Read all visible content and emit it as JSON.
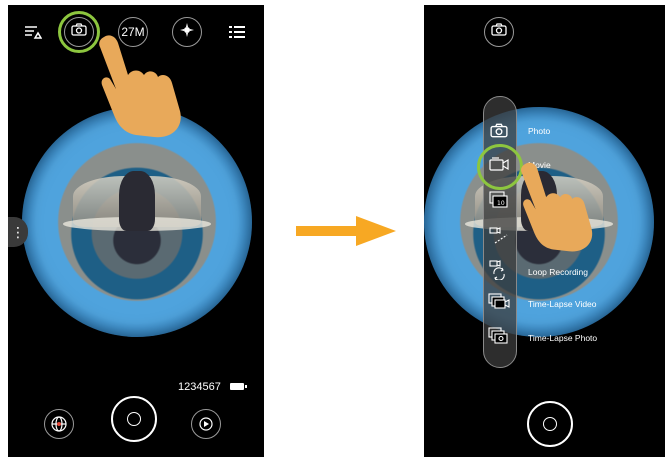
{
  "left_screen": {
    "top_bar": {
      "resolution_label": "27M"
    },
    "status": {
      "shots_remaining": "1234567"
    }
  },
  "right_screen": {
    "mode_menu": {
      "items": [
        {
          "label": "Photo",
          "icon": "camera-icon"
        },
        {
          "label": "Movie",
          "icon": "video-camera-icon"
        },
        {
          "label": "",
          "icon": "burst-10-icon"
        },
        {
          "label": "",
          "icon": "slow-motion-icon"
        },
        {
          "label": "Loop Recording",
          "icon": "loop-recording-icon"
        },
        {
          "label": "Time-Lapse Video",
          "icon": "time-lapse-video-icon"
        },
        {
          "label": "Time-Lapse Photo",
          "icon": "time-lapse-photo-icon"
        }
      ]
    }
  },
  "colors": {
    "highlight": "#8dc63f",
    "arrow": "#f7a823",
    "hand": "#e8a95a"
  }
}
